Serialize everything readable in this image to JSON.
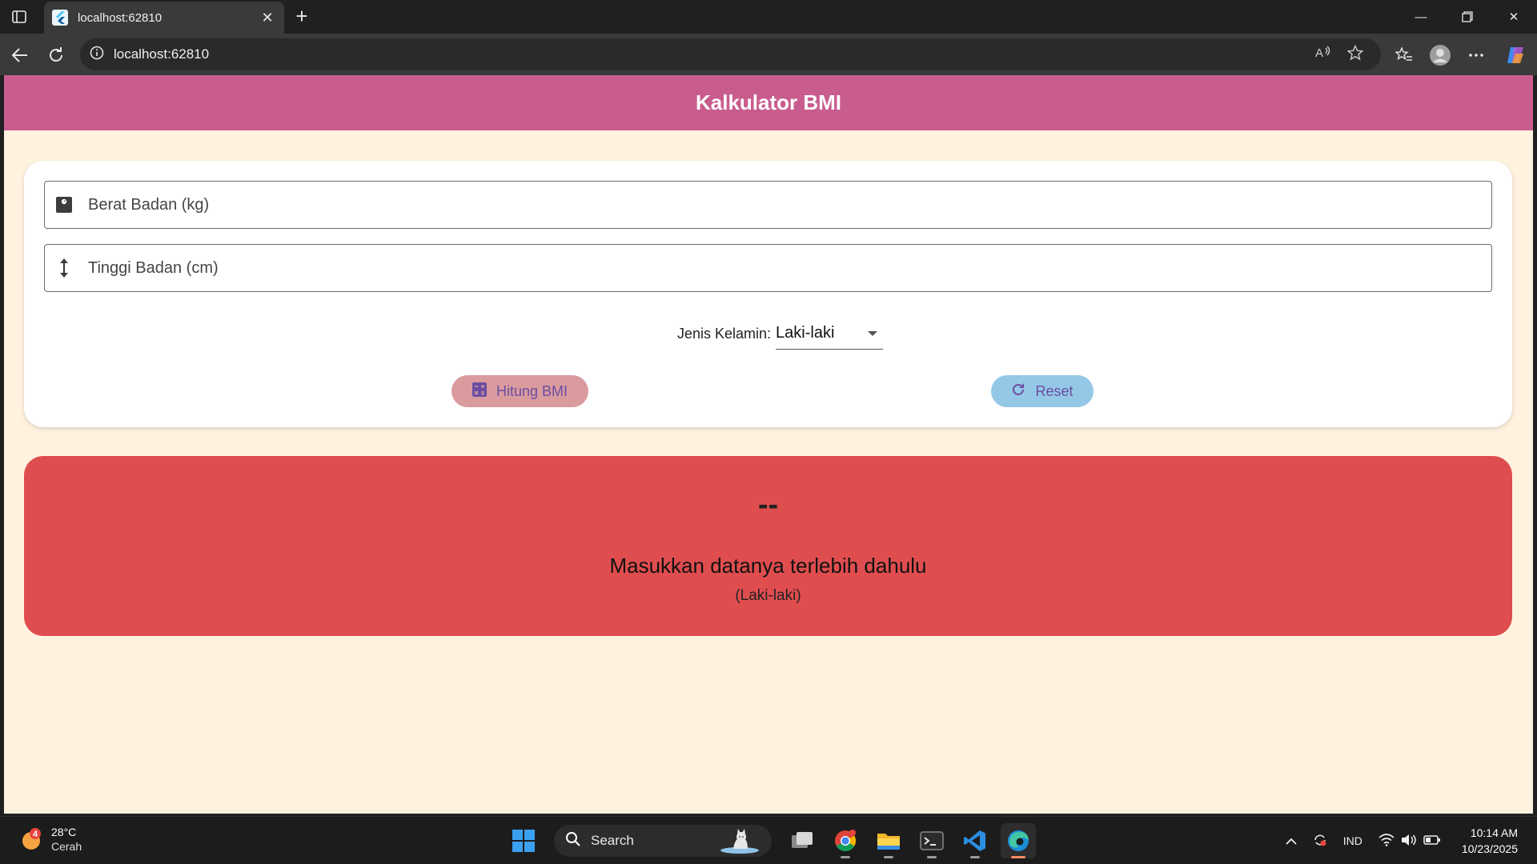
{
  "browser": {
    "tab_title": "localhost:62810",
    "url": "localhost:62810",
    "icons": {
      "tab_actions": "tab-actions-icon",
      "close_tab": "close-icon",
      "new_tab": "plus-icon",
      "back": "back-arrow-icon",
      "refresh": "refresh-icon",
      "site_info": "info-icon",
      "read_aloud": "read-aloud-icon",
      "favorite": "star-icon",
      "favorites": "favorites-list-icon",
      "profile": "profile-icon",
      "more": "more-icon",
      "copilot": "copilot-icon"
    }
  },
  "app": {
    "title": "Kalkulator BMI",
    "colors": {
      "appbar": "#c95c8e",
      "background": "#fff3e0",
      "hitung_button": "#da9b9e",
      "reset_button": "#94c8e6",
      "result_card": "#e04d4f"
    },
    "form": {
      "weight_placeholder": "Berat Badan (kg)",
      "weight_value": "",
      "height_placeholder": "Tinggi Badan (cm)",
      "height_value": "",
      "gender_label": "Jenis Kelamin:",
      "gender_selected": "Laki-laki",
      "hitung_label": "Hitung BMI",
      "reset_label": "Reset"
    },
    "result": {
      "value": "--",
      "message": "Masukkan datanya terlebih dahulu",
      "gender": "(Laki-laki)"
    }
  },
  "taskbar": {
    "weather": {
      "badge": "4",
      "temperature": "28°C",
      "condition": "Cerah"
    },
    "search_label": "Search",
    "language": "IND",
    "time": "10:14 AM",
    "date": "10/23/2025"
  }
}
